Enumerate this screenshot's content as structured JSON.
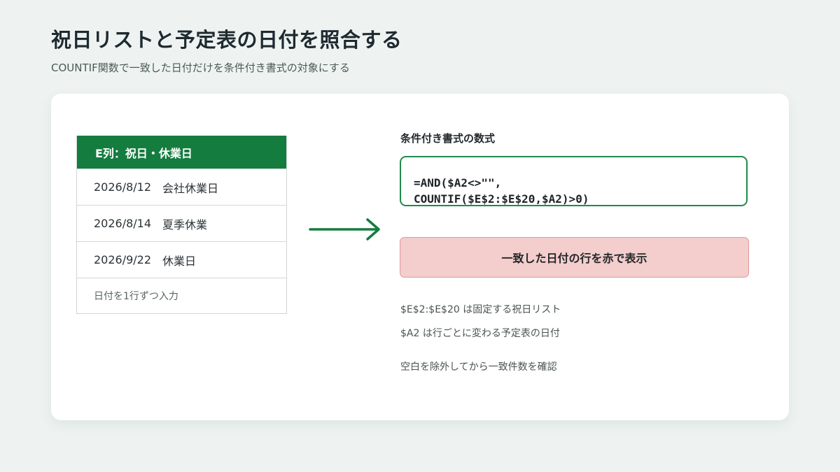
{
  "header": {
    "title": "祝日リストと予定表の日付を照合する",
    "subtitle": "COUNTIF関数で一致した日付だけを条件付き書式の対象にする"
  },
  "table": {
    "header": "E列：祝日・休業日",
    "rows": [
      {
        "date": "2026/8/12",
        "label": "会社休業日"
      },
      {
        "date": "2026/8/14",
        "label": "夏季休業"
      },
      {
        "date": "2026/9/22",
        "label": "休業日"
      }
    ],
    "note": "日付を1行ずつ入力"
  },
  "formula": {
    "label": "条件付き書式の数式",
    "lines": [
      "=AND($A2<>\"\",",
      "COUNTIF($E$2:$E$20,$A2)>0)"
    ]
  },
  "result": {
    "label": "一致した日付の行を赤で表示"
  },
  "notes": [
    "$E$2:$E$20 は固定する祝日リスト",
    "$A2 は行ごとに変わる予定表の日付",
    "空白を除外してから一致件数を確認"
  ],
  "colors": {
    "accent_green": "#147c3f",
    "highlight_red": "#f4cdcd"
  },
  "icons": {
    "arrow": "arrow-right-icon"
  }
}
